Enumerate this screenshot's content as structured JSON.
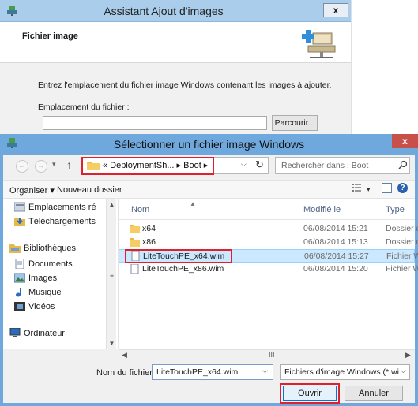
{
  "wizard": {
    "title": "Assistant Ajout d'images",
    "close_label": "x",
    "heading": "Fichier image",
    "instruction": "Entrez l'emplacement du fichier image Windows contenant les images à ajouter.",
    "location_label": "Emplacement du fichier :",
    "location_value": "",
    "browse_label": "Parcourir..."
  },
  "dialog": {
    "title": "Sélectionner un fichier image Windows",
    "close_label": "x",
    "address": "« DeploymentSh... ▸ Boot ▸",
    "search_placeholder": "Rechercher dans : Boot",
    "toolbar": {
      "organize": "Organiser ▾",
      "new_folder": "Nouveau dossier"
    },
    "nav_pane": [
      {
        "label": "Emplacements ré",
        "icon": "recent-places-icon"
      },
      {
        "label": "Téléchargements",
        "icon": "downloads-icon"
      },
      {
        "label": "",
        "icon": ""
      },
      {
        "label": "Bibliothèques",
        "icon": "libraries-icon"
      },
      {
        "label": "Documents",
        "icon": "documents-icon"
      },
      {
        "label": "Images",
        "icon": "images-icon"
      },
      {
        "label": "Musique",
        "icon": "music-icon"
      },
      {
        "label": "Vidéos",
        "icon": "videos-icon"
      },
      {
        "label": "",
        "icon": ""
      },
      {
        "label": "Ordinateur",
        "icon": "computer-icon"
      }
    ],
    "columns": {
      "name": "Nom",
      "modified": "Modifié le",
      "type": "Type"
    },
    "files": [
      {
        "name": "x64",
        "modified": "06/08/2014 15:21",
        "type": "Dossier d",
        "icon": "folder-icon",
        "selected": false
      },
      {
        "name": "x86",
        "modified": "06/08/2014 15:13",
        "type": "Dossier d",
        "icon": "folder-icon",
        "selected": false
      },
      {
        "name": "LiteTouchPE_x64.wim",
        "modified": "06/08/2014 15:27",
        "type": "Fichier W",
        "icon": "file-icon",
        "selected": true
      },
      {
        "name": "LiteTouchPE_x86.wim",
        "modified": "06/08/2014 15:20",
        "type": "Fichier W",
        "icon": "file-icon",
        "selected": false
      }
    ],
    "filename_label": "Nom du fichier :",
    "filename_value": "LiteTouchPE_x64.wim",
    "filetype_value": "Fichiers d'image Windows (*.wi",
    "open_label": "Ouvrir",
    "cancel_label": "Annuler"
  },
  "colors": {
    "title_active": "#6fa8dc",
    "title_inactive": "#a9cdea",
    "highlight": "#e0202c",
    "selection": "#cce8ff"
  }
}
